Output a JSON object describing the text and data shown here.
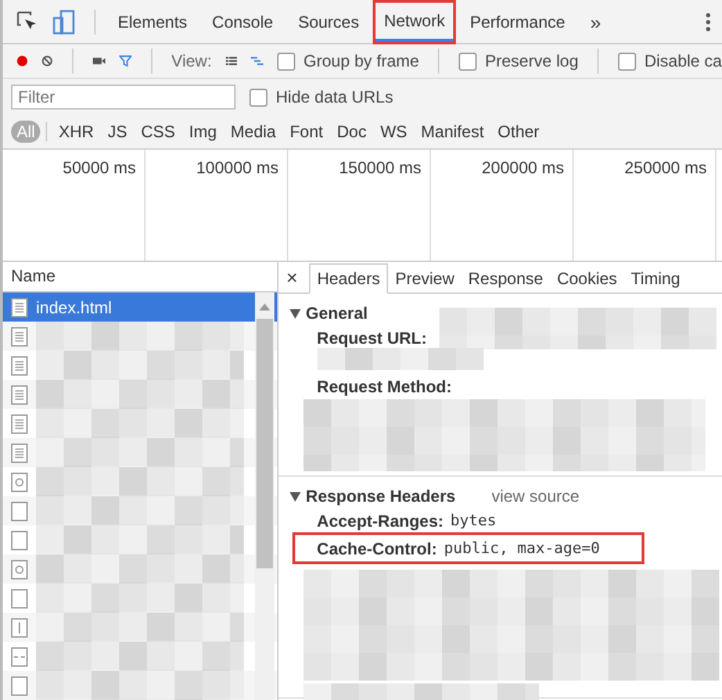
{
  "devtools_tabs": [
    {
      "label": "Elements",
      "selected": false,
      "highlighted": false
    },
    {
      "label": "Console",
      "selected": false,
      "highlighted": false
    },
    {
      "label": "Sources",
      "selected": false,
      "highlighted": false
    },
    {
      "label": "Network",
      "selected": true,
      "highlighted": true
    },
    {
      "label": "Performance",
      "selected": false,
      "highlighted": false
    }
  ],
  "more_tabs": "»",
  "toolbar": {
    "recording": true,
    "filter_on": true,
    "view_label": "View:",
    "large_rows": false,
    "overview": true,
    "checkboxes": [
      {
        "label": "Group by frame",
        "checked": false
      },
      {
        "label": "Preserve log",
        "checked": false
      },
      {
        "label": "Disable ca",
        "checked": false
      }
    ]
  },
  "filter": {
    "placeholder": "Filter",
    "hide_data_urls": {
      "label": "Hide data URLs",
      "checked": false
    }
  },
  "types": [
    {
      "label": "All",
      "selected": true
    },
    {
      "label": "XHR",
      "selected": false
    },
    {
      "label": "JS",
      "selected": false
    },
    {
      "label": "CSS",
      "selected": false
    },
    {
      "label": "Img",
      "selected": false
    },
    {
      "label": "Media",
      "selected": false
    },
    {
      "label": "Font",
      "selected": false
    },
    {
      "label": "Doc",
      "selected": false
    },
    {
      "label": "WS",
      "selected": false
    },
    {
      "label": "Manifest",
      "selected": false
    },
    {
      "label": "Other",
      "selected": false
    }
  ],
  "timeline": {
    "ticks": [
      "50000 ms",
      "100000 ms",
      "150000 ms",
      "200000 ms",
      "250000 ms"
    ]
  },
  "requests": {
    "column": "Name",
    "rows": [
      {
        "name": "index.html",
        "kind": "document",
        "selected": true
      },
      {
        "kind": "document",
        "selected": false
      },
      {
        "kind": "document",
        "selected": false
      },
      {
        "kind": "document",
        "selected": false
      },
      {
        "kind": "document",
        "selected": false
      },
      {
        "kind": "document",
        "selected": false
      },
      {
        "kind": "image",
        "selected": false
      },
      {
        "kind": "blank",
        "selected": false
      },
      {
        "kind": "blank",
        "selected": false
      },
      {
        "kind": "image",
        "selected": false
      },
      {
        "kind": "blank",
        "selected": false
      },
      {
        "kind": "script",
        "selected": false
      },
      {
        "kind": "dashed",
        "selected": false
      },
      {
        "kind": "blank",
        "selected": false
      }
    ]
  },
  "details": {
    "close": "×",
    "tabs": [
      {
        "label": "Headers",
        "selected": true
      },
      {
        "label": "Preview",
        "selected": false
      },
      {
        "label": "Response",
        "selected": false
      },
      {
        "label": "Cookies",
        "selected": false
      },
      {
        "label": "Timing",
        "selected": false
      }
    ],
    "sections": [
      {
        "title": "General",
        "expanded": true,
        "headers": [
          {
            "name": "Request URL:",
            "highlighted": false
          },
          {
            "name": "Request Method:",
            "highlighted": false
          }
        ]
      },
      {
        "title": "Response Headers",
        "expanded": true,
        "link": "view source",
        "headers": [
          {
            "name": "Accept-Ranges:",
            "value": "bytes",
            "highlighted": false
          },
          {
            "name": "Cache-Control:",
            "value": "public, max-age=0",
            "highlighted": true
          }
        ]
      }
    ]
  }
}
